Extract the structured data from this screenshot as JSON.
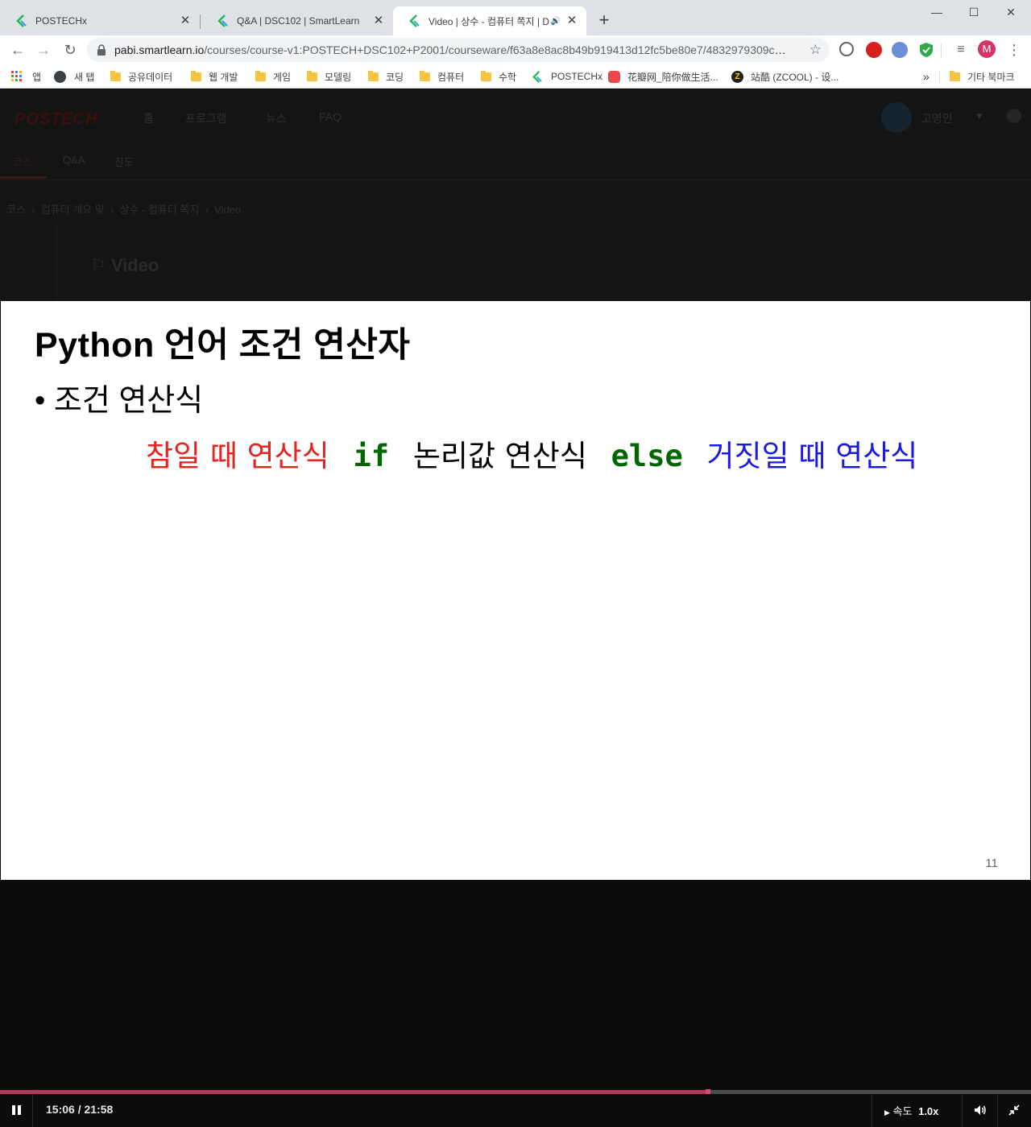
{
  "browser": {
    "tabs": [
      {
        "title": "POSTECHx",
        "active": false
      },
      {
        "title": "Q&A | DSC102 | SmartLearn",
        "active": false
      },
      {
        "title": "Video | 상수 - 컴퓨터 쪽지 | D",
        "active": true
      }
    ],
    "address": {
      "domain": "pabi.smartlearn.io",
      "path": "/courses/course-v1:POSTECH+DSC102+P2001/courseware/f63a8e8ac8b49b919413d12fc5be80e7/4832979309ce5ff1..."
    },
    "profile_initial": "M",
    "bookmarks": [
      {
        "label": "앱",
        "icon": "apps-grid-icon"
      },
      {
        "label": "새 탭",
        "icon": "globe-icon"
      },
      {
        "label": "공유데이터",
        "icon": "folder-icon"
      },
      {
        "label": "웹 개발",
        "icon": "folder-icon"
      },
      {
        "label": "게임",
        "icon": "folder-icon"
      },
      {
        "label": "모델링",
        "icon": "folder-icon"
      },
      {
        "label": "코딩",
        "icon": "folder-icon"
      },
      {
        "label": "컴퓨터",
        "icon": "folder-icon"
      },
      {
        "label": "수학",
        "icon": "folder-icon"
      },
      {
        "label": "POSTECHx",
        "icon": "smartlearn-icon"
      },
      {
        "label": "花瓣网_陪你做生活...",
        "icon": "huaban-icon"
      },
      {
        "label": "站酷 (ZCOOL) - 设...",
        "icon": "zcool-icon"
      }
    ],
    "overflow_label": "»",
    "other_bookmarks": "기타 북마크"
  },
  "site": {
    "logo": "POSTECH",
    "nav": [
      "홈",
      "프로그램",
      "뉴스",
      "FAQ"
    ],
    "user": "고영인",
    "course_tabs": [
      "코스",
      "Q&A",
      "진도"
    ],
    "breadcrumb": [
      "코스",
      "컴퓨터 개요 및",
      "상수 - 컴퓨터 쪽지",
      "Video"
    ],
    "unit_title": "Video"
  },
  "slide": {
    "title": "Python 언어 조건 연산자",
    "bullet": "• 조건 연산식",
    "formula": {
      "true_expr": "참일 때 연산식",
      "if_kw": "if",
      "cond": "논리값 연산식",
      "else_kw": "else",
      "false_expr": "거짓일 때 연산식"
    },
    "page_number": "11"
  },
  "player": {
    "current_time": "15:06",
    "duration": "21:58",
    "timer_text": "15:06 / 21:58",
    "progress": 0.687,
    "speed_label": "속도",
    "speed_value": "1.0x"
  },
  "colors": {
    "true_expr": "#e8221e",
    "keyword": "#006600",
    "cond": "#000000",
    "false_expr": "#1a1ae0",
    "progress_fill": "#b3395b",
    "smartlearn_green": "#1db954"
  }
}
